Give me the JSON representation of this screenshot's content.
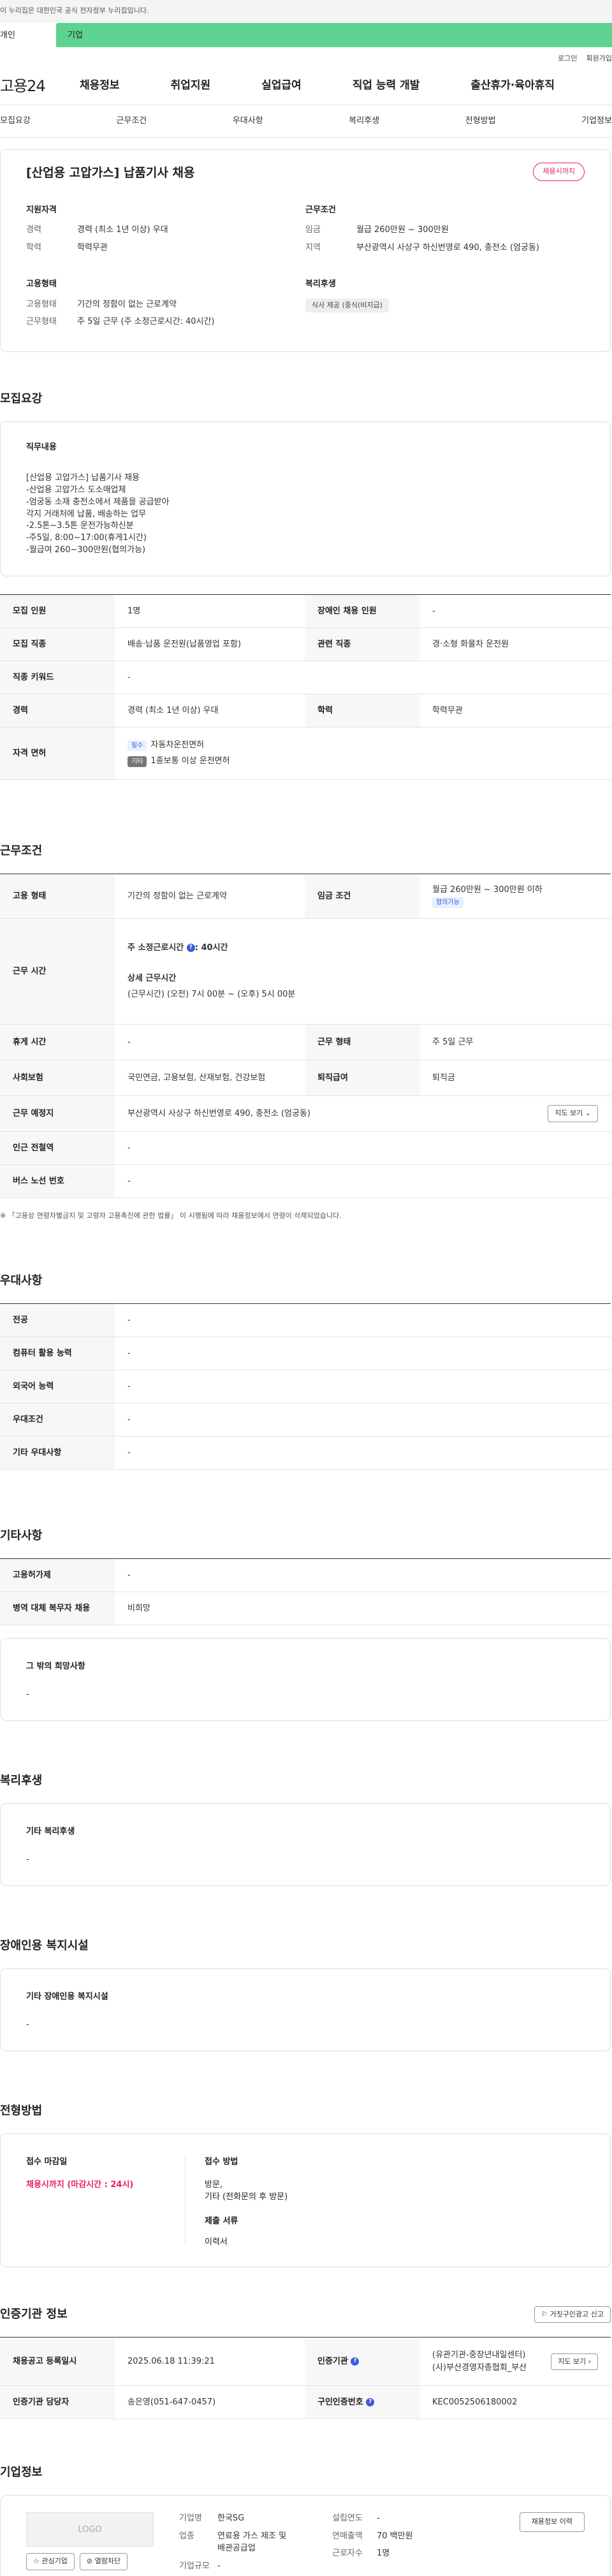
{
  "gov_banner": "이 누리집은 대한민국 공식 전자정부 누리집입니다.",
  "site_tabs": {
    "personal": "개인",
    "company": "기업"
  },
  "util": {
    "login": "로그인",
    "signup": "회원가입"
  },
  "logo": "고용24",
  "gnb": [
    "채용정보",
    "취업지원",
    "실업급여",
    "직업 능력 개발",
    "출산휴가·육아휴직"
  ],
  "lnb": [
    "모집요강",
    "근무조건",
    "우대사항",
    "복리후생",
    "전형방법",
    "기업정보"
  ],
  "summary": {
    "title": "[산업용 고압가스] 납품기사 채용",
    "deadline_badge": "채용시까지",
    "qual": {
      "heading": "지원자격",
      "career_k": "경력",
      "career_v": "경력 (최소 1년 이상) 우대",
      "edu_k": "학력",
      "edu_v": "학력무관"
    },
    "cond": {
      "heading": "근무조건",
      "wage_k": "임금",
      "wage_v": "월급 260만원 ~ 300만원",
      "area_k": "지역",
      "area_v": "부산광역시 사상구 하신번영로 490, 충전소 (엄궁동)"
    },
    "emp": {
      "heading": "고용형태",
      "type_k": "고용형태",
      "type_v": "기간의 정함이 없는 근로계약",
      "hours_k": "근무형태",
      "hours_v": "주 5일 근무 (주 소정근로시간: 40시간)"
    },
    "welfare": {
      "heading": "복리후생",
      "tag": "식사 제공 (중식(비지급)"
    }
  },
  "req": {
    "section": "모집요강",
    "job_heading": "직무내용",
    "job_text": "[산업용 고압가스] 납품기사 채용\n-산업용 고압가스 도소매업체\n-엄궁동 소재 충전소에서 제품을 공급받아\n각지 거래처에 납품, 배송하는 업무\n-2.5톤~3.5톤 운전가능하신분\n-주5일, 8:00~17:00(휴게1시간)\n-월급여 260~300만원(협의가능)",
    "rows": {
      "count_k": "모집 인원",
      "count_v": "1명",
      "dis_k": "장애인 채용 인원",
      "dis_v": "-",
      "job_k": "모집 직종",
      "job_v": "배송·납품 운전원(납품영업 포함)",
      "rel_k": "관련 직종",
      "rel_v": "경·소형 화물차 운전원",
      "kw_k": "직종 키워드",
      "kw_v": "-",
      "car_k": "경력",
      "car_v": "경력 (최소 1년 이상) 우대",
      "edu_k": "학력",
      "edu_v": "학력무관",
      "lic_k": "자격 면허",
      "lic_pref": "필수",
      "lic1": "자동차운전면허",
      "lic_type": "기타",
      "lic2": "1종보통 이상 운전면허"
    }
  },
  "work": {
    "section": "근무조건",
    "emp_k": "고용 형태",
    "emp_v": "기간의 정함이 없는 근로계약",
    "wage_k": "임금 조건",
    "wage_v": "월급 260만원 ~ 300만원 이하",
    "wage_tag": "협의가능",
    "time_k": "근무 시간",
    "time_week_label": "주 소정근로시간",
    "time_week_v": ": 40시간",
    "time_detail_label": "상세 근무시간",
    "time_detail_v": "(근무시간) (오전) 7시 00분 ~ (오후) 5시 00분",
    "rest_k": "휴게 시간",
    "rest_v": "-",
    "form_k": "근무 형태",
    "form_v": "주 5일 근무",
    "ins_k": "사회보험",
    "ins_v": "국민연금, 고용보험, 산재보험, 건강보험",
    "ret_k": "퇴직급여",
    "ret_v": "퇴직금",
    "place_k": "근무 예정지",
    "place_v": "부산광역시 사상구 하신번영로 490, 충전소 (엄궁동)",
    "map_btn": "지도 보기",
    "subway_k": "인근 전철역",
    "subway_v": "-",
    "bus_k": "버스 노선 번호",
    "bus_v": "-",
    "note": "※ 「고용상 연령차별금지 및 고령자 고용촉진에 관한 법률」 이 시행됨에 따라 채용정보에서 연령이 삭제되었습니다."
  },
  "pref": {
    "section": "우대사항",
    "major_k": "전공",
    "major_v": "-",
    "pc_k": "컴퓨터 활용 능력",
    "pc_v": "-",
    "lang_k": "외국어 능력",
    "lang_v": "-",
    "cond_k": "우대조건",
    "cond_v": "-",
    "etc_k": "기타 우대사항",
    "etc_v": "-"
  },
  "etc": {
    "section": "기타사항",
    "disab_k": "고용허가제",
    "disab_v": "-",
    "army_k": "병역 대체 복무자 채용",
    "army_v": "비희망",
    "other_heading": "그 밖의 희망사항",
    "other_v": "-"
  },
  "welfare": {
    "section": "복리후생",
    "heading": "기타 복리후생",
    "v": "-"
  },
  "disfac": {
    "section": "장애인용 복지시설",
    "heading": "기타 장애인용 복지시설",
    "v": "-"
  },
  "select": {
    "section": "전형방법",
    "deadline_h": "접수 마감일",
    "deadline_v": "채용시까지 (마감시간 : 24시)",
    "method_h": "접수 방법",
    "method_v1": "방문,",
    "method_v2": "기타 (전화문의 후 방문)",
    "docs_h": "제출 서류",
    "docs_v": "이력서"
  },
  "agency": {
    "section": "인증기관 정보",
    "report_btn": "거짓구인광고 신고",
    "reg_k": "채용공고 등록일시",
    "reg_v": "2025.06.18 11:39:21",
    "org_k": "인증기관",
    "org_v1": "(유관기관-중장년내일센터)",
    "org_v2": "(사)부산경영자총협회_부산",
    "map_btn": "지도 보기",
    "mgr_k": "인증기관 담당자",
    "mgr_v": "송은영(051-647-0457)",
    "no_k": "구인인증번호",
    "no_v": "KEC0052506180002"
  },
  "company": {
    "section": "기업정보",
    "logo_placeholder": "LOGO",
    "fav_btn": "관심기업",
    "block_btn": "열람차단",
    "name_k": "기업명",
    "name_v": "한국SG",
    "ind_k": "업종",
    "ind_v": "연료용 가스 제조 및 배관공급업",
    "size_k": "기업규모",
    "size_v": "-",
    "est_k": "설립연도",
    "est_v": "-",
    "rev_k": "연매출액",
    "rev_v": "70 백만원",
    "emp_k": "근로자수",
    "emp_v": "1명",
    "history_btn": "채용정보 이력"
  }
}
